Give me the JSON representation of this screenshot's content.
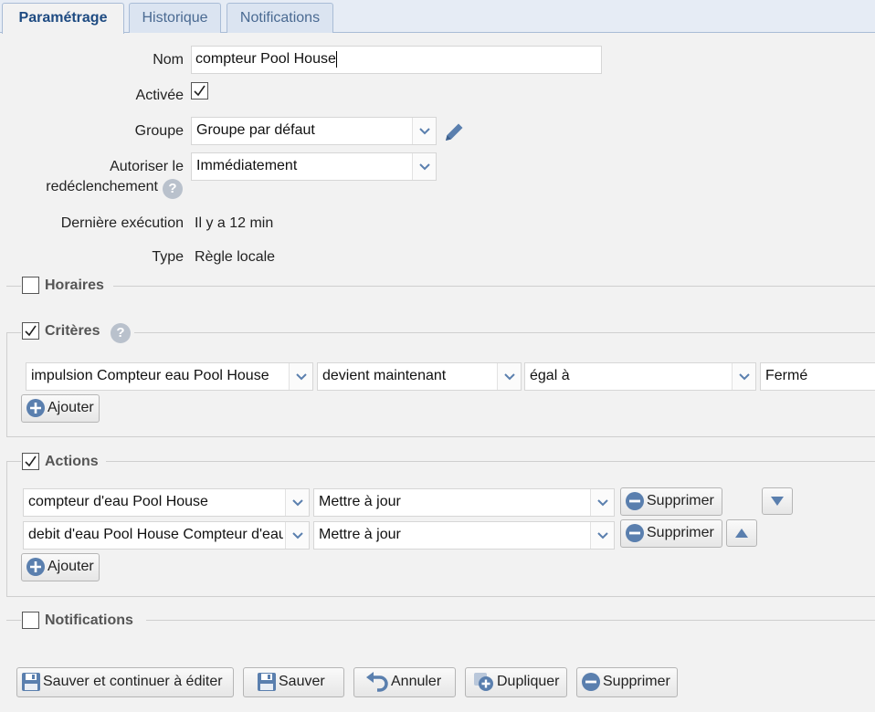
{
  "tabs": [
    "Paramétrage",
    "Historique",
    "Notifications"
  ],
  "form": {
    "name_label": "Nom",
    "name_value": "compteur Pool House",
    "active_label": "Activée",
    "active_checked": true,
    "group_label": "Groupe",
    "group_value": "Groupe par défaut",
    "retrigger_label_1": "Autoriser le",
    "retrigger_label_2": "redéclenchement",
    "retrigger_value": "Immédiatement",
    "last_exec_label": "Dernière exécution",
    "last_exec_value": "Il y a 12 min",
    "type_label": "Type",
    "type_value": "Règle locale"
  },
  "sections": {
    "schedules": {
      "label": "Horaires",
      "checked": false
    },
    "criteria": {
      "label": "Critères",
      "checked": true
    },
    "actions": {
      "label": "Actions",
      "checked": true
    },
    "notifications": {
      "label": "Notifications",
      "checked": false
    }
  },
  "criteria_row": {
    "device": "impulsion Compteur eau Pool House",
    "event": "devient maintenant",
    "operator": "égal à",
    "value": "Fermé"
  },
  "actions_rows": [
    {
      "device": "compteur d'eau Pool House",
      "action": "Mettre à jour"
    },
    {
      "device": "debit d'eau Pool House Compteur d'eau",
      "action": "Mettre à jour"
    }
  ],
  "labels": {
    "help": "?",
    "add": "Ajouter",
    "delete": "Supprimer",
    "save_continue": "Sauver et continuer à éditer",
    "save": "Sauver",
    "cancel": "Annuler",
    "duplicate": "Dupliquer",
    "delete_rule": "Supprimer"
  },
  "colors": {
    "accent": "#1e4b82",
    "icon_blue": "#5a7fae"
  }
}
